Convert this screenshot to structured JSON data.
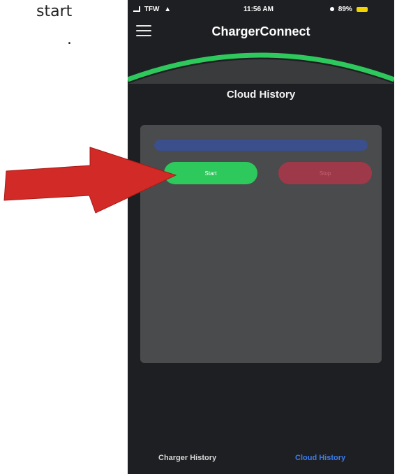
{
  "document": {
    "line1": "start",
    "line2": "."
  },
  "status_bar": {
    "carrier": "TFW",
    "time": "11:56 AM",
    "battery": "89%"
  },
  "header": {
    "app_title": "ChargerConnect"
  },
  "page": {
    "title": "Cloud History"
  },
  "panel": {
    "progress_fraction": 1.0,
    "start_label": "Start",
    "stop_label": "Stop"
  },
  "tabs": {
    "charger_history": "Charger History",
    "cloud_history": "Cloud History"
  },
  "colors": {
    "accent_green": "#2ec95c",
    "stop_red": "#9e3949",
    "progress_blue": "#3a4f8c",
    "active_tab_blue": "#3a7df0",
    "annotation_arrow_red": "#d22a26"
  }
}
